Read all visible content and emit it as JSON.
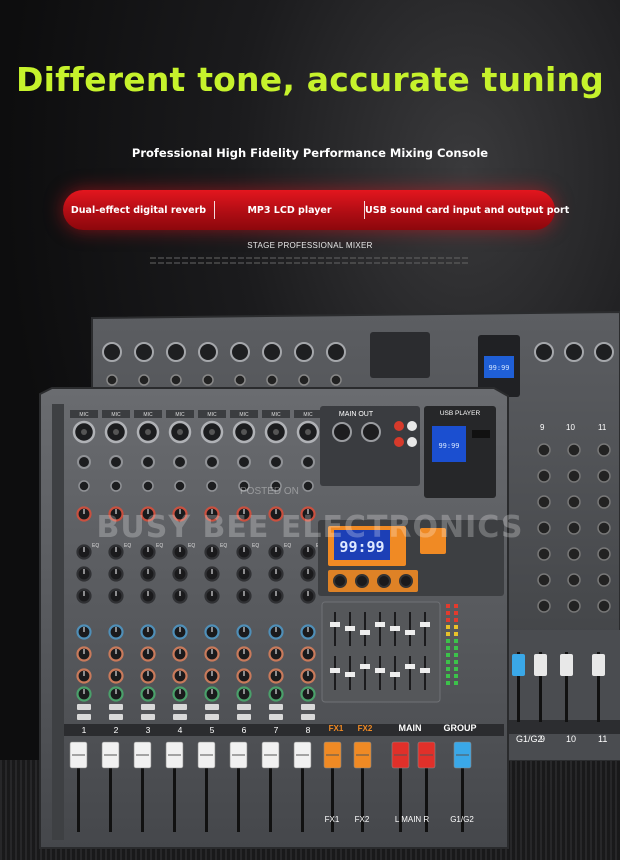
{
  "headline": "Different tone, accurate tuning",
  "subtitle": "Professional High Fidelity Performance Mixing Console",
  "features": [
    "Dual-effect digital reverb",
    "MP3 LCD player",
    "USB sound card input and output port"
  ],
  "caption": "STAGE PROFESSIONAL MIXER",
  "watermark": {
    "small": "POSTED ON",
    "large": "BUSY BEE ELECTRONICS"
  },
  "mixer": {
    "main_out_label": "MAIN OUT",
    "usb_player_label": "USB PLAYER",
    "mic_label": "MIC",
    "eq_label": "EQ",
    "display_digits": "99:99",
    "channel_numbers": [
      "1",
      "2",
      "3",
      "4",
      "5",
      "6",
      "7",
      "8"
    ],
    "back_channel_numbers": [
      "9",
      "10",
      "11"
    ],
    "fx_labels": [
      "FX1",
      "FX2"
    ],
    "main_label": "MAIN",
    "group_label": "GROUP",
    "main_lr_label": "L MAIN R",
    "group_fader_label": "G1/G2",
    "back_group_label": "G1/G2",
    "accent_orange": "#f08a24",
    "accent_red": "#e0302a",
    "accent_blue": "#3aa8e8",
    "body_gray": "#55575b"
  }
}
